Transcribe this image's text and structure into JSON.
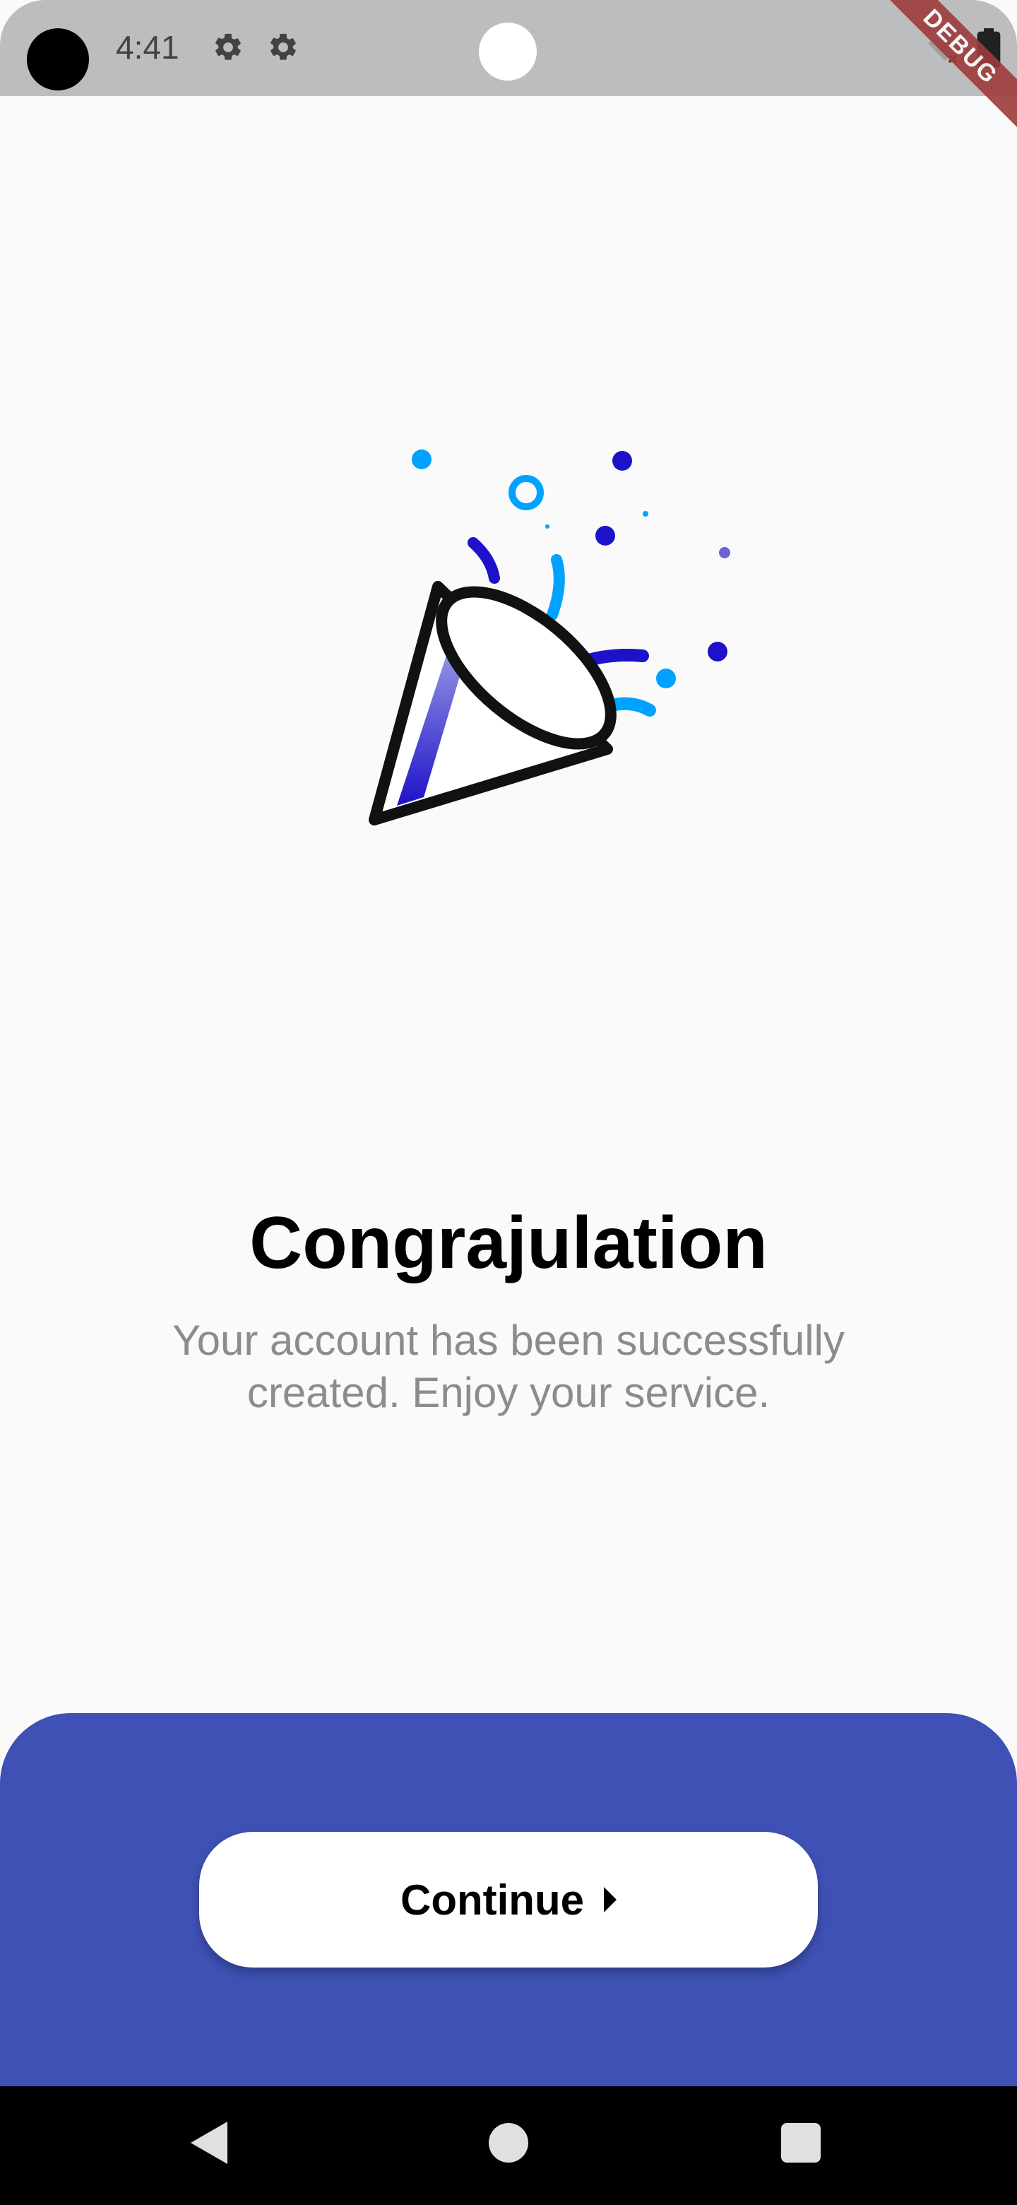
{
  "status_bar": {
    "time": "4:41",
    "debug": "DEBUG",
    "icons": [
      "settings-icon",
      "settings-icon",
      "wifi-off-icon",
      "battery-icon"
    ]
  },
  "content": {
    "title": "Congrajulation",
    "subtitle": "Your account has been successfully created. Enjoy your service."
  },
  "actions": {
    "continue_label": "Continue",
    "continue_icon": "arrow-right-icon"
  },
  "colors": {
    "accent": "#3f51b5",
    "background": "#fafafa",
    "confetti_blue": "#00a2ff",
    "confetti_indigo": "#1d12c9"
  },
  "nav": {
    "icons": [
      "back-icon",
      "home-icon",
      "recents-icon"
    ]
  }
}
